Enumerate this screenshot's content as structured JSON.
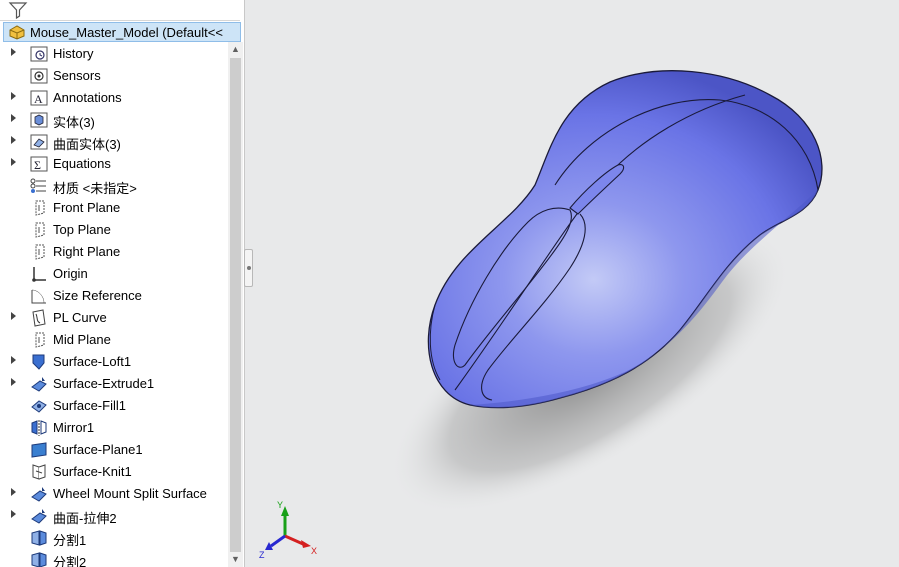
{
  "feature_tree": {
    "root_label": "Mouse_Master_Model  (Default<<",
    "items": [
      {
        "label": "History",
        "expandable": true,
        "icon": "history-folder-icon"
      },
      {
        "label": "Sensors",
        "expandable": false,
        "icon": "sensors-folder-icon"
      },
      {
        "label": "Annotations",
        "expandable": true,
        "icon": "annotations-folder-icon"
      },
      {
        "label": "实体(3)",
        "expandable": true,
        "icon": "solid-bodies-folder-icon"
      },
      {
        "label": "曲面实体(3)",
        "expandable": true,
        "icon": "surface-bodies-folder-icon"
      },
      {
        "label": "Equations",
        "expandable": true,
        "icon": "equations-folder-icon"
      },
      {
        "label": "材质 <未指定>",
        "expandable": false,
        "icon": "material-icon"
      },
      {
        "label": "Front Plane",
        "expandable": false,
        "icon": "plane-icon"
      },
      {
        "label": "Top Plane",
        "expandable": false,
        "icon": "plane-icon"
      },
      {
        "label": "Right Plane",
        "expandable": false,
        "icon": "plane-icon"
      },
      {
        "label": "Origin",
        "expandable": false,
        "icon": "origin-icon"
      },
      {
        "label": "Size Reference",
        "expandable": false,
        "icon": "sketch-icon"
      },
      {
        "label": "PL Curve",
        "expandable": true,
        "icon": "curve-icon"
      },
      {
        "label": "Mid Plane",
        "expandable": false,
        "icon": "plane-icon"
      },
      {
        "label": "Surface-Loft1",
        "expandable": true,
        "icon": "surface-loft-icon"
      },
      {
        "label": "Surface-Extrude1",
        "expandable": true,
        "icon": "surface-extrude-icon"
      },
      {
        "label": "Surface-Fill1",
        "expandable": false,
        "icon": "surface-fill-icon"
      },
      {
        "label": "Mirror1",
        "expandable": false,
        "icon": "mirror-icon"
      },
      {
        "label": "Surface-Plane1",
        "expandable": false,
        "icon": "surface-plane-icon"
      },
      {
        "label": "Surface-Knit1",
        "expandable": false,
        "icon": "surface-knit-icon"
      },
      {
        "label": "Wheel Mount Split Surface",
        "expandable": true,
        "icon": "surface-extrude-icon"
      },
      {
        "label": "曲面-拉伸2",
        "expandable": true,
        "icon": "surface-extrude-icon"
      },
      {
        "label": "分割1",
        "expandable": false,
        "icon": "split-icon"
      },
      {
        "label": "分割2",
        "expandable": false,
        "icon": "split-icon"
      }
    ]
  },
  "model": {
    "body_color": "#6570e6",
    "edge_color": "#1a1a3a"
  },
  "triad": {
    "x_label": "X",
    "y_label": "Y",
    "z_label": "Z",
    "x_color": "#d42020",
    "y_color": "#18a018",
    "z_color": "#2828d0"
  }
}
